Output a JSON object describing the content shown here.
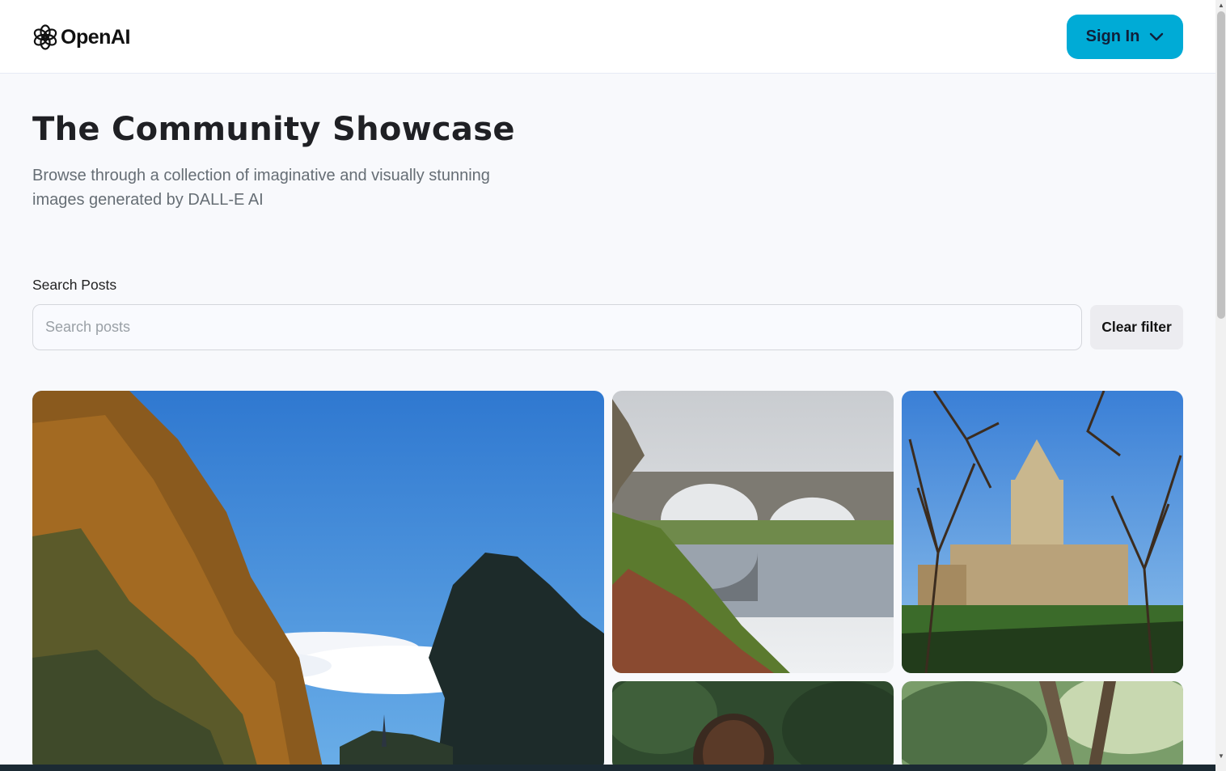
{
  "header": {
    "logo_text": "OpenAI",
    "signin_label": "Sign In"
  },
  "hero": {
    "title": "The Community Showcase",
    "subtitle": "Browse through a collection of imaginative and visually stunning images generated by DALL-E AI"
  },
  "search": {
    "label": "Search Posts",
    "placeholder": "Search posts",
    "value": "",
    "clear_label": "Clear filter"
  },
  "gallery": {
    "items": [
      {
        "icon": "autumn-trees-sky-image"
      },
      {
        "icon": "stone-bridge-river-image"
      },
      {
        "icon": "gothic-building-trees-image"
      },
      {
        "icon": "person-portrait-image"
      },
      {
        "icon": "tree-foliage-image"
      }
    ]
  },
  "colors": {
    "accent": "#00abd6",
    "background": "#f8f9fc",
    "header_bg": "#ffffff",
    "subtitle": "#666e75"
  }
}
